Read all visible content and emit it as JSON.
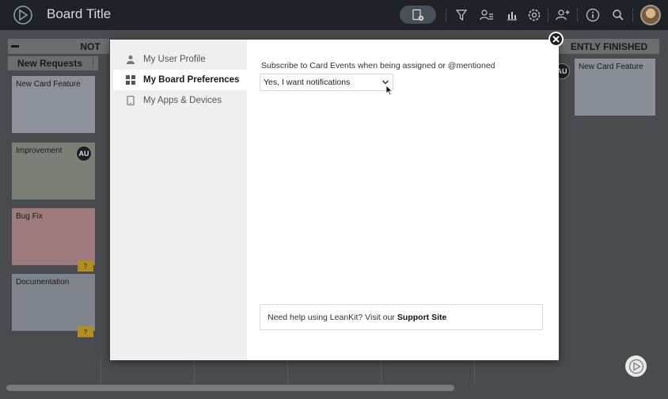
{
  "topbar": {
    "title": "Board Title",
    "icons": [
      "logo-icon",
      "add-card-icon",
      "filter-icon",
      "people-filter-icon",
      "analytics-icon",
      "settings-icon",
      "add-user-icon",
      "info-icon",
      "search-icon",
      "avatar"
    ]
  },
  "board": {
    "lanes": [
      {
        "label": "NOT"
      },
      {
        "label": "ENTLY FINISHED"
      }
    ],
    "sub_lane": "New Requests",
    "cards": [
      {
        "title": "New Card Feature",
        "color": "#8b9099"
      },
      {
        "title": "Improvement",
        "color": "#7b8077",
        "badge": "AU"
      },
      {
        "title": "Bug Fix",
        "color": "#9e7a7c",
        "tag": "?"
      },
      {
        "title": "Documentation",
        "color": "#80848c",
        "tag": "?"
      }
    ],
    "right_card": {
      "title": "New Card Feature",
      "color": "#898e97"
    },
    "right_badge": "AU"
  },
  "modal": {
    "nav": [
      {
        "label": "My User Profile",
        "icon": "user-icon",
        "active": false
      },
      {
        "label": "My Board Preferences",
        "icon": "grid-icon",
        "active": true
      },
      {
        "label": "My Apps & Devices",
        "icon": "device-icon",
        "active": false
      }
    ],
    "preference": {
      "label": "Subscribe to Card Events when being assigned or @mentioned",
      "selected": "Yes, I want notifications"
    },
    "help": {
      "text": "Need help using LeanKit? Visit our",
      "link": "Support Site"
    }
  },
  "colors": {
    "topbar": "#1f2328",
    "modal_sidebar": "#efefef",
    "accent_dark": "#1b1d20"
  }
}
